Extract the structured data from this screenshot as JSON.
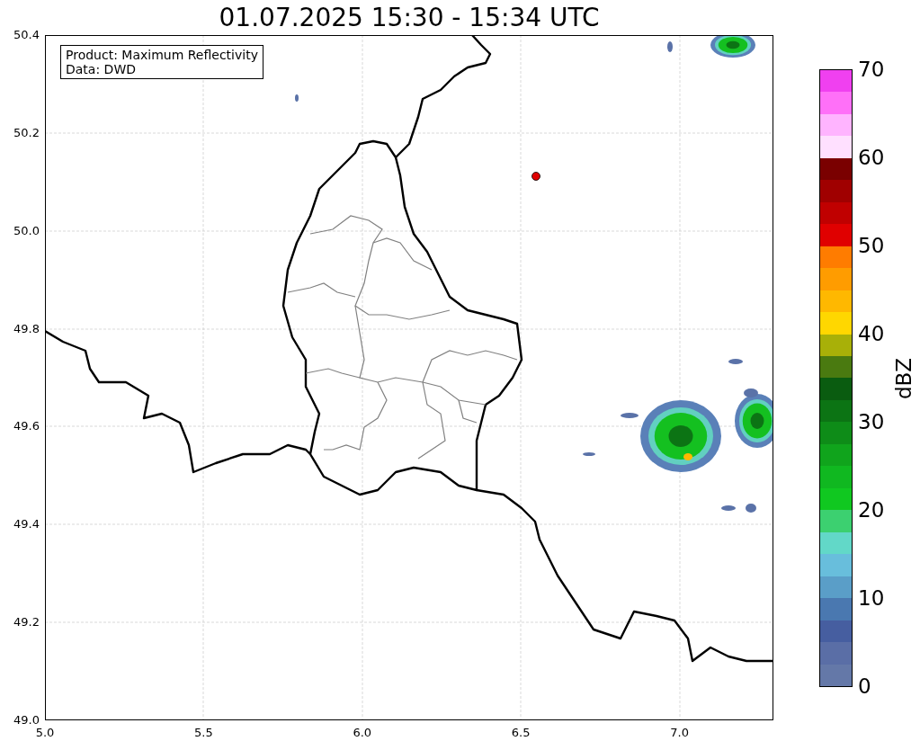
{
  "title": "01.07.2025 15:30 - 15:34 UTC",
  "info_box": [
    "Product: Maximum Reflectivity",
    "Data: DWD"
  ],
  "x_ticks": [
    "5.0",
    "5.5",
    "6.0",
    "6.5",
    "7.0"
  ],
  "y_ticks": [
    "50.4",
    "50.2",
    "50.0",
    "49.8",
    "49.6",
    "49.4",
    "49.2",
    "49.0"
  ],
  "colorbar": {
    "label": "dBZ",
    "ticks": [
      "70",
      "60",
      "50",
      "40",
      "30",
      "20",
      "10",
      "0"
    ]
  }
}
